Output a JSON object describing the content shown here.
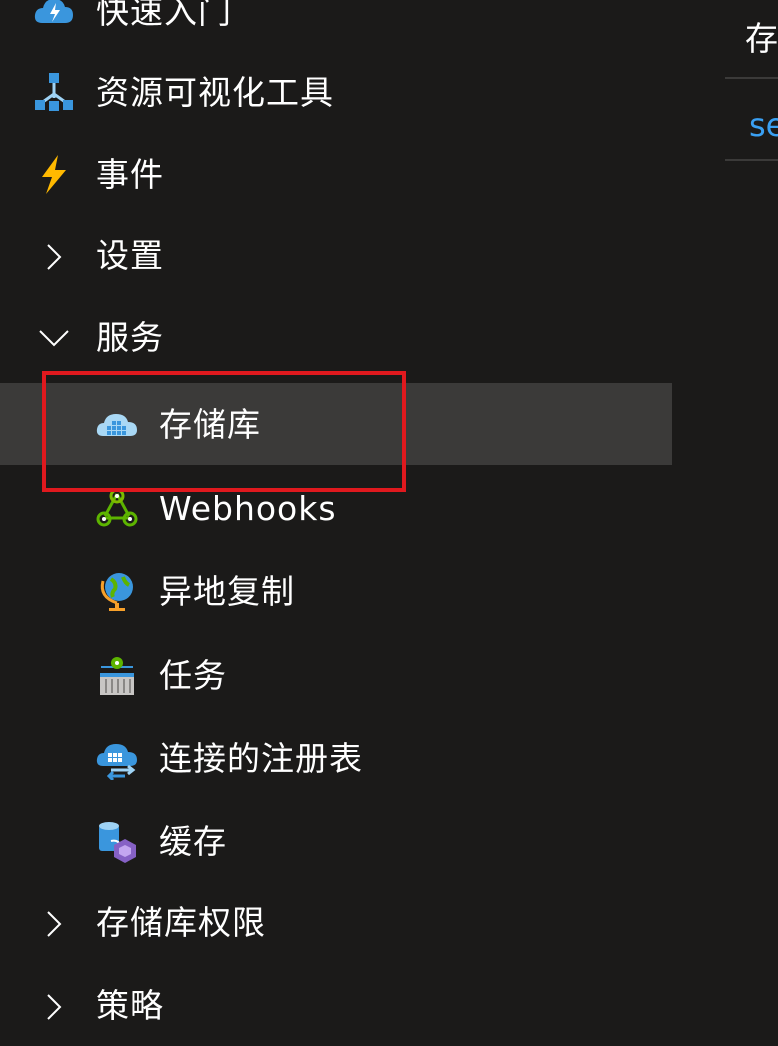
{
  "sidebar": {
    "items": [
      {
        "label": "快速入门",
        "icon": "quickstart-cloud-icon"
      },
      {
        "label": "资源可视化工具",
        "icon": "resource-visualizer-icon"
      },
      {
        "label": "事件",
        "icon": "events-lightning-icon"
      },
      {
        "label": "设置",
        "icon": "chevron-right-icon"
      },
      {
        "label": "服务",
        "icon": "chevron-down-icon"
      },
      {
        "label": "存储库",
        "icon": "repositories-icon",
        "selected": true
      },
      {
        "label": "Webhooks",
        "icon": "webhooks-icon"
      },
      {
        "label": "异地复制",
        "icon": "geo-replication-globe-icon"
      },
      {
        "label": "任务",
        "icon": "tasks-icon"
      },
      {
        "label": "连接的注册表",
        "icon": "connected-registries-icon"
      },
      {
        "label": "缓存",
        "icon": "cache-icon"
      },
      {
        "label": "存储库权限",
        "icon": "chevron-right-icon"
      },
      {
        "label": "策略",
        "icon": "chevron-right-icon"
      }
    ]
  },
  "right_panel": {
    "title": "存",
    "link": "se"
  },
  "colors": {
    "background": "#1b1a19",
    "selected_row": "#3b3a39",
    "highlight_border": "#e0191e",
    "link": "#3aa0f3"
  }
}
